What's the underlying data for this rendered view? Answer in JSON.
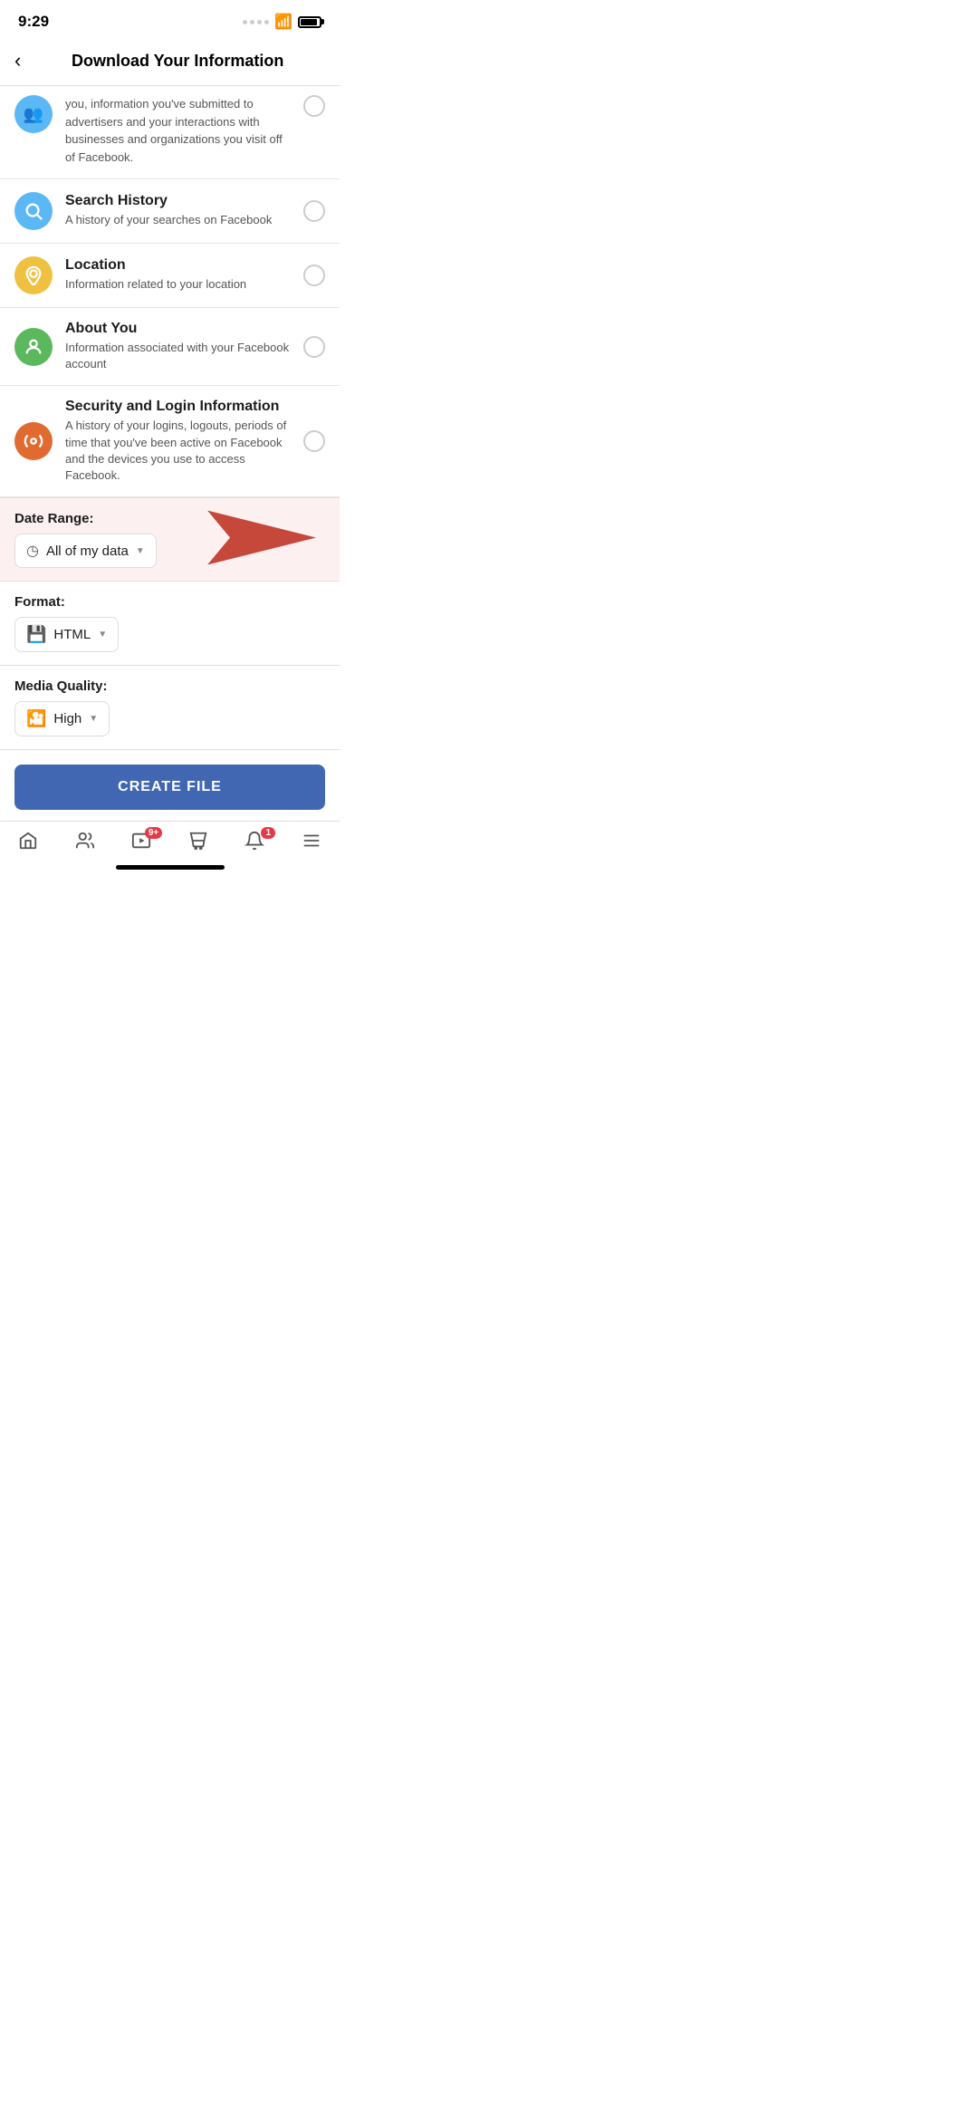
{
  "statusBar": {
    "time": "9:29"
  },
  "header": {
    "backLabel": "‹",
    "title": "Download Your Information"
  },
  "partialItem": {
    "text": "you, information you've submitted to advertisers and your interactions with businesses and organizations you visit off of Facebook."
  },
  "listItems": [
    {
      "id": "search-history",
      "iconColor": "icon-blue",
      "iconSymbol": "🔍",
      "title": "Search History",
      "description": "A history of your searches on Facebook",
      "checked": false
    },
    {
      "id": "location",
      "iconColor": "icon-yellow",
      "iconSymbol": "📍",
      "title": "Location",
      "description": "Information related to your location",
      "checked": false
    },
    {
      "id": "about-you",
      "iconColor": "icon-green",
      "iconSymbol": "👤",
      "title": "About You",
      "description": "Information associated with your Facebook account",
      "checked": false
    },
    {
      "id": "security-login",
      "iconColor": "icon-orange",
      "iconSymbol": "🔑",
      "title": "Security and Login Information",
      "description": "A history of your logins, logouts, periods of time that you've been active on Facebook and the devices you use to access Facebook.",
      "checked": false
    }
  ],
  "dateRange": {
    "label": "Date Range:",
    "value": "All of my data",
    "arrowIndicator": true
  },
  "format": {
    "label": "Format:",
    "value": "HTML"
  },
  "mediaQuality": {
    "label": "Media Quality:",
    "value": "High"
  },
  "createButton": {
    "label": "CREATE FILE"
  },
  "bottomNav": {
    "items": [
      {
        "id": "home",
        "label": "Home",
        "badge": null
      },
      {
        "id": "friends",
        "label": "Friends",
        "badge": null
      },
      {
        "id": "watch",
        "label": "Watch",
        "badge": "9+"
      },
      {
        "id": "marketplace",
        "label": "Marketplace",
        "badge": null
      },
      {
        "id": "notifications",
        "label": "Notifications",
        "badge": "1"
      },
      {
        "id": "menu",
        "label": "Menu",
        "badge": null
      }
    ]
  }
}
